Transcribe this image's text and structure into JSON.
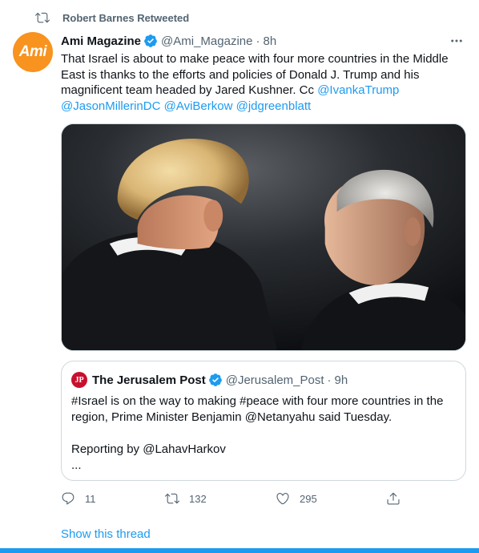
{
  "retweet_banner": {
    "text": "Robert Barnes Retweeted",
    "icon": "retweet-icon"
  },
  "tweet": {
    "author": {
      "name": "Ami Magazine",
      "handle": "@Ami_Magazine",
      "avatar_text": "Ami",
      "avatar_color": "#f7931e",
      "verified": true
    },
    "separator": "·",
    "time": "8h",
    "text_lines": [
      "That Israel is about to make peace with four more countries in the Middle",
      "East is thanks to the efforts and policies of Donald J. Trump and his",
      "magnificent team headed by Jared Kushner. Cc "
    ],
    "mentions": [
      "@IvankaTrump",
      "@JasonMillerinDC",
      "@AviBerkow",
      "@jdgreenblatt"
    ],
    "quote": {
      "author": {
        "name": "The Jerusalem Post",
        "handle": "@Jerusalem_Post",
        "logo_text": "JP",
        "logo_color": "#c8102e",
        "verified": true
      },
      "separator": "·",
      "time": "9h",
      "text_lines": [
        "#Israel is on the way to making #peace with four more countries in the",
        "region, Prime Minister Benjamin @Netanyahu said Tuesday.",
        "",
        "Reporting by @LahavHarkov",
        "..."
      ]
    },
    "actions": {
      "reply_count": "11",
      "retweet_count": "132",
      "like_count": "295"
    },
    "show_thread": "Show this thread"
  },
  "colors": {
    "accent": "#1d9bf0",
    "secondary_text": "#536471",
    "border": "#cfd9de"
  }
}
